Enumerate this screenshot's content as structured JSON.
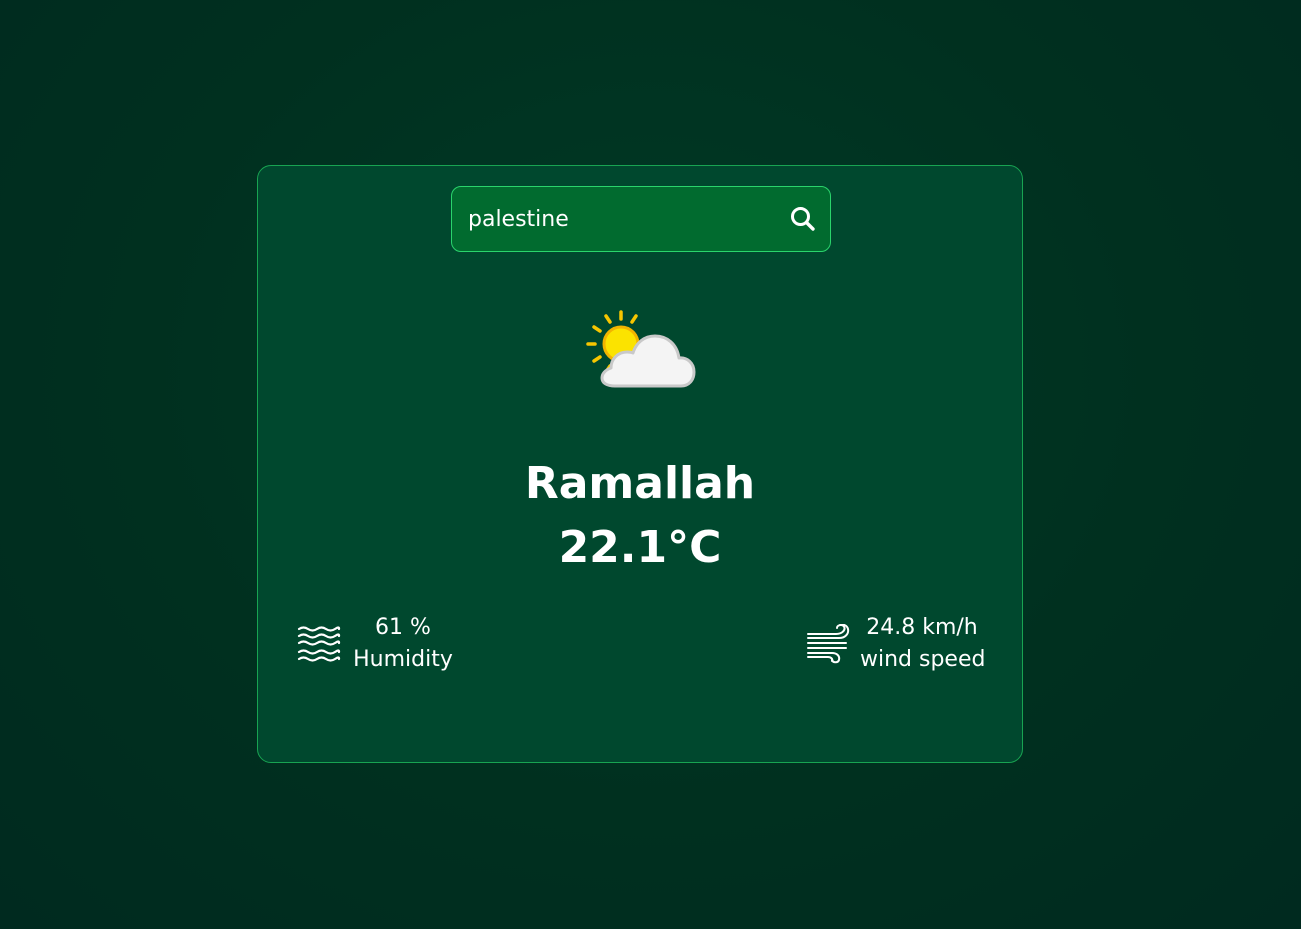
{
  "search": {
    "value": "palestine",
    "button_icon": "search-icon"
  },
  "weather": {
    "icon": "partly-cloudy-icon",
    "city": "Ramallah",
    "temperature": "22.1°C"
  },
  "humidity": {
    "icon": "humidity-waves-icon",
    "value": "61 %",
    "label": "Humidity"
  },
  "wind": {
    "icon": "wind-icon",
    "value": "24.8 km/h",
    "label": "wind speed"
  },
  "colors": {
    "page_background": "#002c22",
    "card_background": "#00482e",
    "card_border": "#18a452",
    "search_background": "#016b2f",
    "search_border": "#2ad46c",
    "sun": "#f7c600",
    "cloud": "#f2f2f2"
  }
}
